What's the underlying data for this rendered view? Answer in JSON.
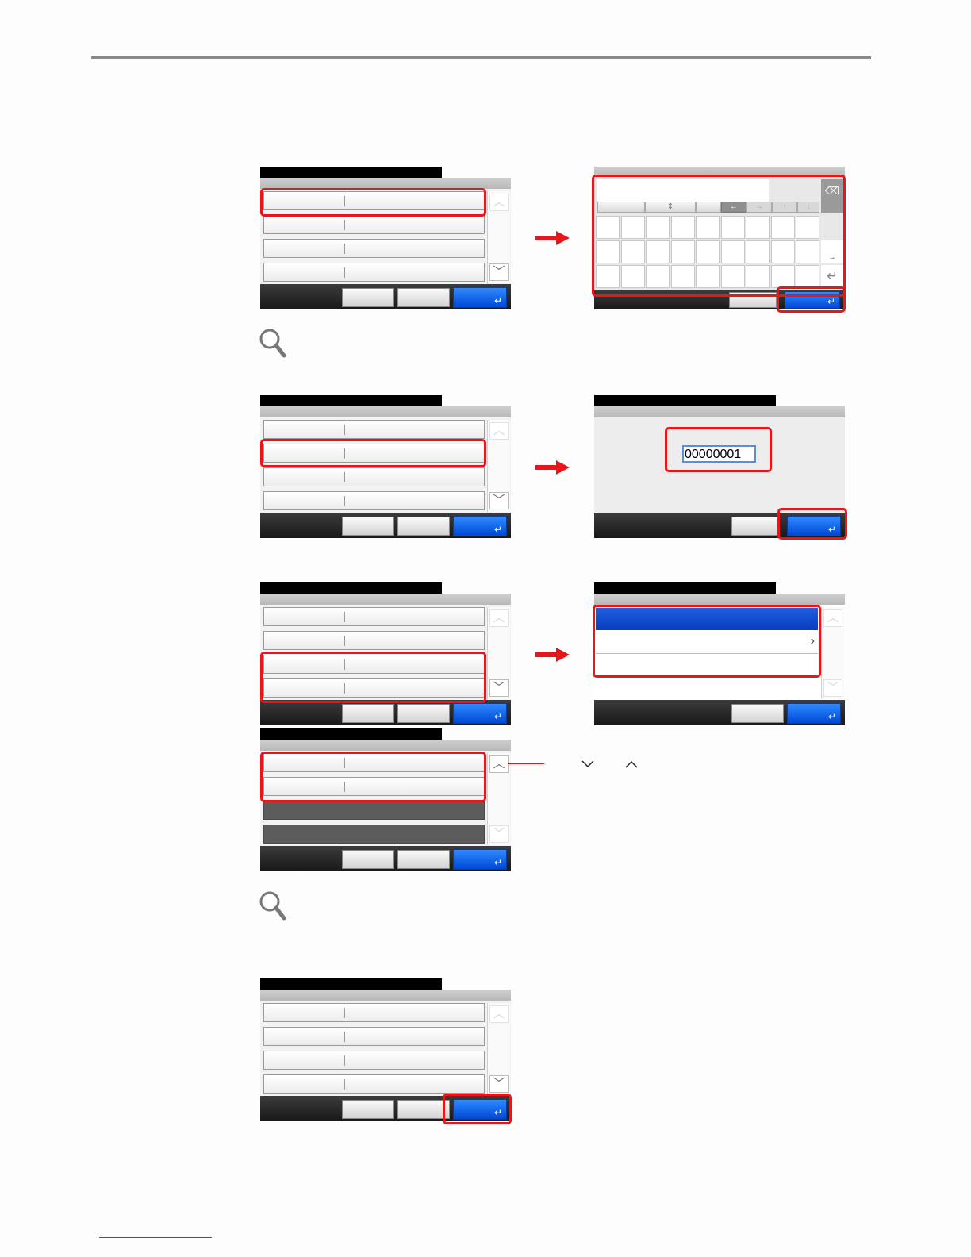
{
  "step2": {
    "input_value": "00000001"
  },
  "icons": {
    "magnifier": "magnifier-icon",
    "scroll_up": "chevron-up-icon",
    "scroll_down": "chevron-down-icon",
    "enter": "enter-icon",
    "backspace": "backspace-icon",
    "arrow_right": "right-arrow-icon"
  },
  "colors": {
    "highlight": "#e8161b",
    "ok_button": "#0a5be8",
    "title_bar": "#000000"
  }
}
